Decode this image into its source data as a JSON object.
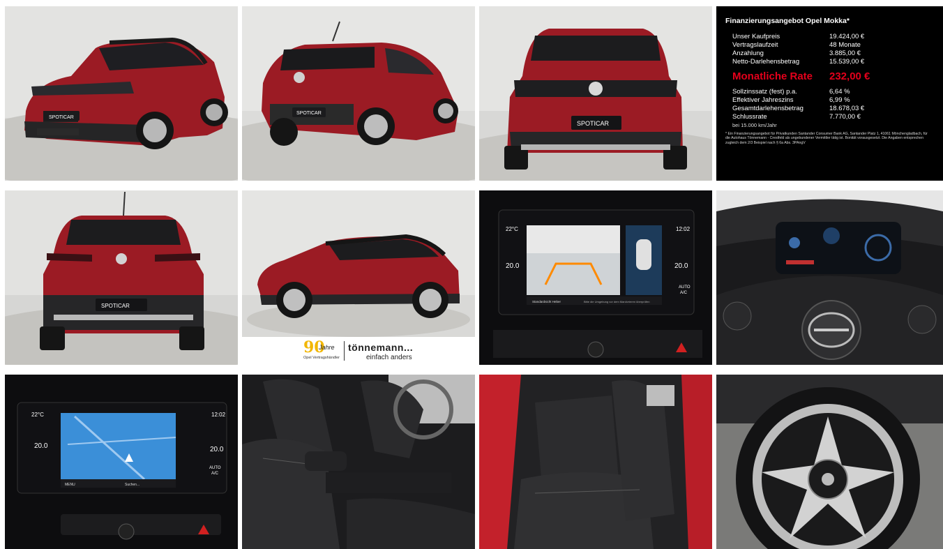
{
  "finance": {
    "title": "Finanzierungsangebot Opel Mokka*",
    "rows": [
      {
        "label": "Unser Kaufpreis",
        "value": "19.424,00 €"
      },
      {
        "label": "Vertragslaufzeit",
        "value": "48 Monate"
      },
      {
        "label": "Anzahlung",
        "value": "3.885,00 €"
      },
      {
        "label": "Netto-Darlehensbetrag",
        "value": "15.539,00 €"
      }
    ],
    "rate_label": "Monatliche Rate",
    "rate_value": "232,00 €",
    "rows2": [
      {
        "label": "Sollzinssatz (fest) p.a.",
        "value": "6,64 %"
      },
      {
        "label": "Effektiver Jahreszins",
        "value": "6,99 %"
      },
      {
        "label": "Gesamtdarlehensbetrag",
        "value": "18.678,03 €"
      },
      {
        "label": "Schlussrate",
        "value": "7.770,00 €"
      }
    ],
    "mileage_note": "bei 15.000 km/Jahr",
    "footnote": "* Ein Finanzierungsangebot für Privatkunden Santander Consumer Bank AG, Santander Platz 1, 41061 Mönchengladbach, für die Autohaus Tönnemann - Crestfeld als ungebundener Vermittler tätig ist. Bonität vorausgesetzt. Die Angaben entsprechen zugleich dem 2/3 Beispiel nach § 6a Abs. 3PAngV"
  },
  "plates": {
    "dealer_plate": "SPOTICAR"
  },
  "dealer_banner": {
    "ninety": "90",
    "jahre": "Jahre",
    "partner": "Opel Vertragshändler",
    "brand": "tönnemann...",
    "slogan": "einfach anders"
  },
  "camera_screen": {
    "temp_left": "22°C",
    "temp_left_value": "20.0",
    "clock": "12:02",
    "temp_right_value": "20.0",
    "auto_label": "AUTO",
    "ac_label": "A/C",
    "view_label": "Standardsicht Heber",
    "hint": "Bitte die Umgebung vor dem Manövrieren überprüfen"
  },
  "nav_screen": {
    "temp_left": "22°C",
    "temp_left_value": "20.0",
    "clock": "12:02",
    "temp_right_value": "20.0",
    "auto_label": "AUTO",
    "ac_label": "A/C",
    "menu_label": "MENU",
    "search_label": "Suchen..."
  },
  "colors": {
    "car_red": "#9b1b24",
    "finance_rate": "#e3001b",
    "banner_gold": "#f2b705",
    "nav_blue": "#3b8fd8"
  }
}
